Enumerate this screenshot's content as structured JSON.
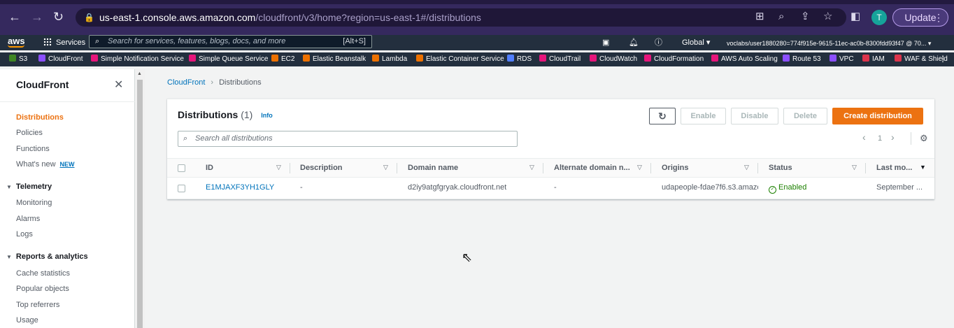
{
  "browser": {
    "url_host": "us-east-1.console.aws.amazon.com",
    "url_path": "/cloudfront/v3/home?region=us-east-1#/distributions",
    "avatar_letter": "T",
    "update_label": "Update"
  },
  "aws_header": {
    "logo": "aws",
    "services_label": "Services",
    "search_placeholder": "Search for services, features, blogs, docs, and more",
    "search_shortcut": "[Alt+S]",
    "region": "Global ▾",
    "account": "voclabs/user1880280=774f915e-9615-11ec-ac0b-8300fdd93f47 @ 70... ▾"
  },
  "favorites": [
    {
      "label": "S3",
      "color": "#3f8624"
    },
    {
      "label": "CloudFront",
      "color": "#8c4fff"
    },
    {
      "label": "Simple Notification Service",
      "color": "#e7157b"
    },
    {
      "label": "Simple Queue Service",
      "color": "#e7157b"
    },
    {
      "label": "EC2",
      "color": "#ed7100"
    },
    {
      "label": "Elastic Beanstalk",
      "color": "#ed7100"
    },
    {
      "label": "Lambda",
      "color": "#ed7100"
    },
    {
      "label": "Elastic Container Service",
      "color": "#ed7100"
    },
    {
      "label": "RDS",
      "color": "#527fff"
    },
    {
      "label": "CloudTrail",
      "color": "#e7157b"
    },
    {
      "label": "CloudWatch",
      "color": "#e7157b"
    },
    {
      "label": "CloudFormation",
      "color": "#e7157b"
    },
    {
      "label": "AWS Auto Scaling",
      "color": "#e7157b"
    },
    {
      "label": "Route 53",
      "color": "#8c4fff"
    },
    {
      "label": "VPC",
      "color": "#8c4fff"
    },
    {
      "label": "IAM",
      "color": "#dd344c"
    },
    {
      "label": "WAF & Shield",
      "color": "#dd344c"
    }
  ],
  "sidebar": {
    "title": "CloudFront",
    "items": [
      {
        "label": "Distributions"
      },
      {
        "label": "Policies"
      },
      {
        "label": "Functions"
      },
      {
        "label": "What's new",
        "badge": "NEW"
      }
    ],
    "telemetry": {
      "title": "Telemetry",
      "items": [
        "Monitoring",
        "Alarms",
        "Logs"
      ]
    },
    "reports": {
      "title": "Reports & analytics",
      "items": [
        "Cache statistics",
        "Popular objects",
        "Top referrers",
        "Usage"
      ]
    }
  },
  "breadcrumb": {
    "root": "CloudFront",
    "current": "Distributions"
  },
  "panel": {
    "title": "Distributions",
    "count": "(1)",
    "info": "Info",
    "buttons": {
      "enable": "Enable",
      "disable": "Disable",
      "delete": "Delete",
      "create": "Create distribution"
    },
    "search_placeholder": "Search all distributions",
    "page": "1",
    "columns": [
      "ID",
      "Description",
      "Domain name",
      "Alternate domain n...",
      "Origins",
      "Status",
      "Last mo..."
    ],
    "rows": [
      {
        "id": "E1MJAXF3YH1GLY",
        "description": "-",
        "domain": "d2iy9atgfgryak.cloudfront.net",
        "alternate": "-",
        "origins": "udapeople-fdae7f6.s3.amazo",
        "status": "Enabled",
        "last_modified": "September ..."
      }
    ]
  }
}
